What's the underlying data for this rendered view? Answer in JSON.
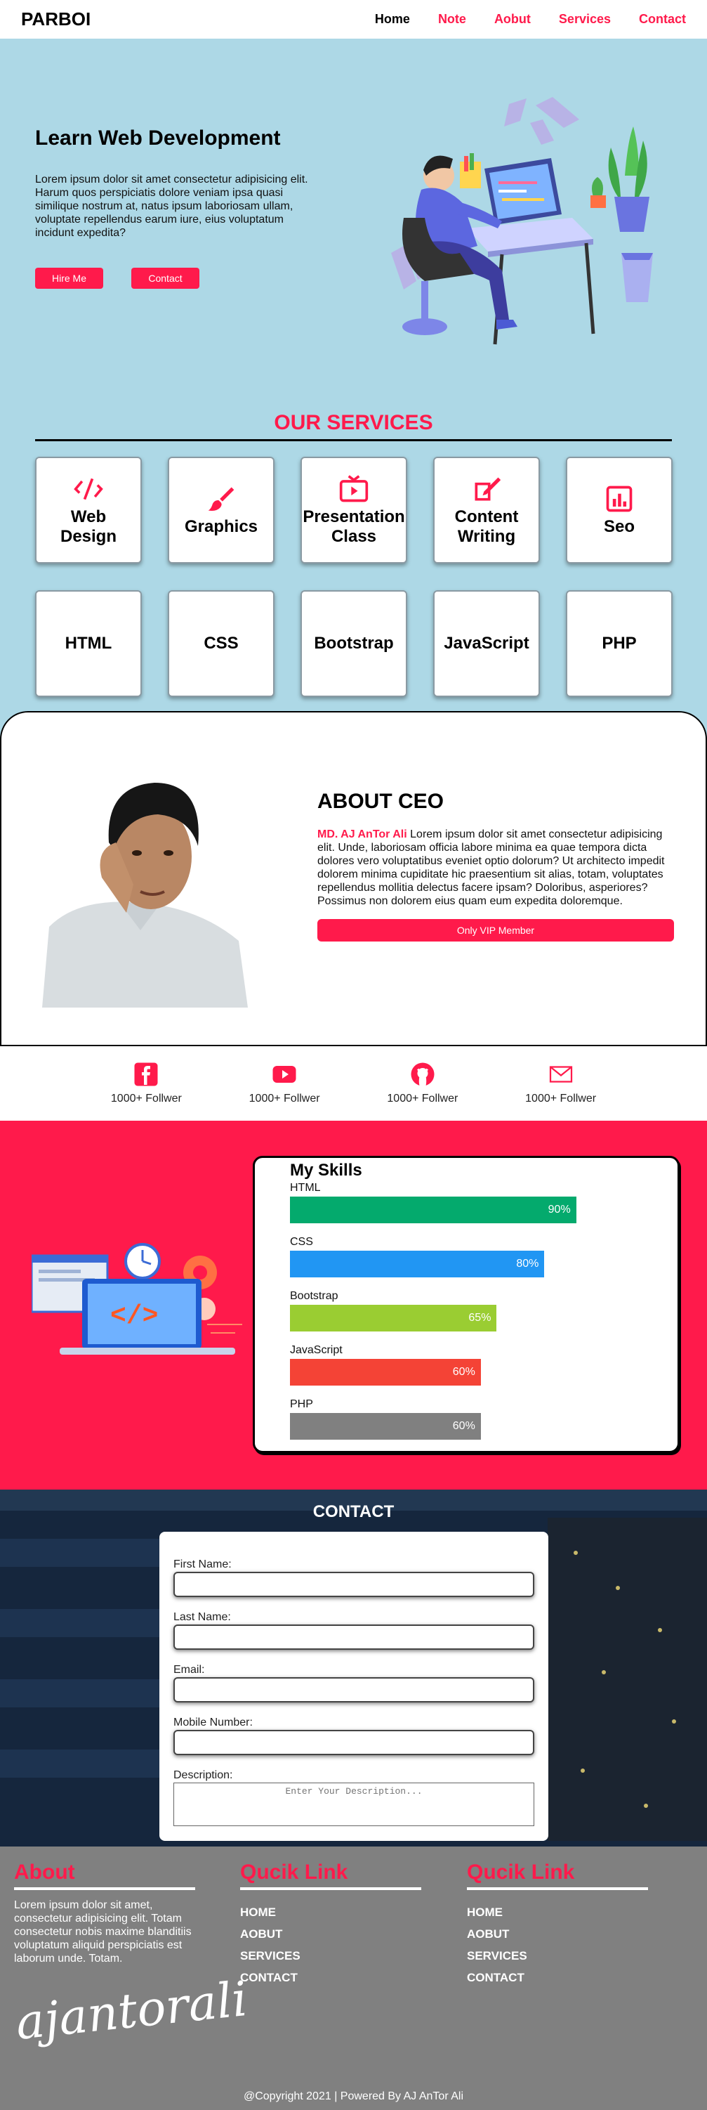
{
  "nav": {
    "brand": "PARBOI",
    "items": [
      "Home",
      "Note",
      "Aobut",
      "Services",
      "Contact"
    ]
  },
  "hero": {
    "title": "Learn Web Development",
    "text": "Lorem ipsum dolor sit amet consectetur adipisicing elit. Harum quos perspiciatis dolore veniam ipsa quasi similique nostrum at, natus ipsum laboriosam ullam, voluptate repellendus earum iure, eius voluptatum incidunt expedita?",
    "btn_hire": "Hire Me",
    "btn_contact": "Contact"
  },
  "services": {
    "title": "OUR SERVICES",
    "cards": [
      {
        "label": "Web Design",
        "icon": "code-slash-icon"
      },
      {
        "label": "Graphics",
        "icon": "brush-icon"
      },
      {
        "label": "Presentation Class",
        "icon": "play-screen-icon"
      },
      {
        "label": "Content Writing",
        "icon": "pen-note-icon"
      },
      {
        "label": "Seo",
        "icon": "bar-chart-icon"
      },
      {
        "label": "HTML"
      },
      {
        "label": "CSS"
      },
      {
        "label": "Bootstrap"
      },
      {
        "label": "JavaScript"
      },
      {
        "label": "PHP"
      }
    ]
  },
  "about": {
    "title": "ABOUT CEO",
    "name": "MD. AJ AnTor Ali",
    "text": " Lorem ipsum dolor sit amet consectetur adipisicing elit. Unde, laboriosam officia labore minima ea quae tempora dicta dolores vero voluptatibus eveniet optio dolorum? Ut architecto impedit dolorem minima cupiditate hic praesentium sit alias, totam, voluptates repellendus mollitia delectus facere ipsam? Doloribus, asperiores? Possimus non dolorem eius quam eum expedita doloremque.",
    "vip": "Only VIP Member"
  },
  "social": [
    {
      "icon": "facebook-icon",
      "text": "1000+ Follwer"
    },
    {
      "icon": "youtube-icon",
      "text": "1000+ Follwer"
    },
    {
      "icon": "github-icon",
      "text": "1000+ Follwer"
    },
    {
      "icon": "mail-icon",
      "text": "1000+ Follwer"
    }
  ],
  "skills": {
    "title": "My Skills",
    "items": [
      {
        "name": "HTML",
        "percent": 90,
        "label": "90%",
        "color": "#04aa6d"
      },
      {
        "name": "CSS",
        "percent": 80,
        "label": "80%",
        "color": "#2196f3"
      },
      {
        "name": "Bootstrap",
        "percent": 65,
        "label": "65%",
        "color": "#9acd32"
      },
      {
        "name": "JavaScript",
        "percent": 60,
        "label": "60%",
        "color": "#f44336"
      },
      {
        "name": "PHP",
        "percent": 60,
        "label": "60%",
        "color": "#808080"
      }
    ]
  },
  "contact": {
    "title": "CONTACT",
    "first": "First Name:",
    "last": "Last Name:",
    "email": "Email:",
    "mobile": "Mobile Number:",
    "desc": "Description:",
    "desc_placeholder": "Enter Your Description..."
  },
  "footer": {
    "about_title": "About",
    "about_text": "Lorem ipsum dolor sit amet, consectetur adipisicing elit. Totam consectetur nobis maxime blanditiis voluptatum aliquid perspiciatis est laborum unde. Totam.",
    "signature": "ajantorali",
    "links_title_1": "Qucik Link",
    "links_title_2": "Qucik Link",
    "links": [
      "HOME",
      "AOBUT",
      "SERVICES",
      "CONTACT"
    ],
    "copyright": "@Copyright 2021 | Powered By AJ AnTor Ali"
  },
  "colors": {
    "accent": "#ff1a4b",
    "sky": "#add8e6",
    "footer": "#808080"
  }
}
